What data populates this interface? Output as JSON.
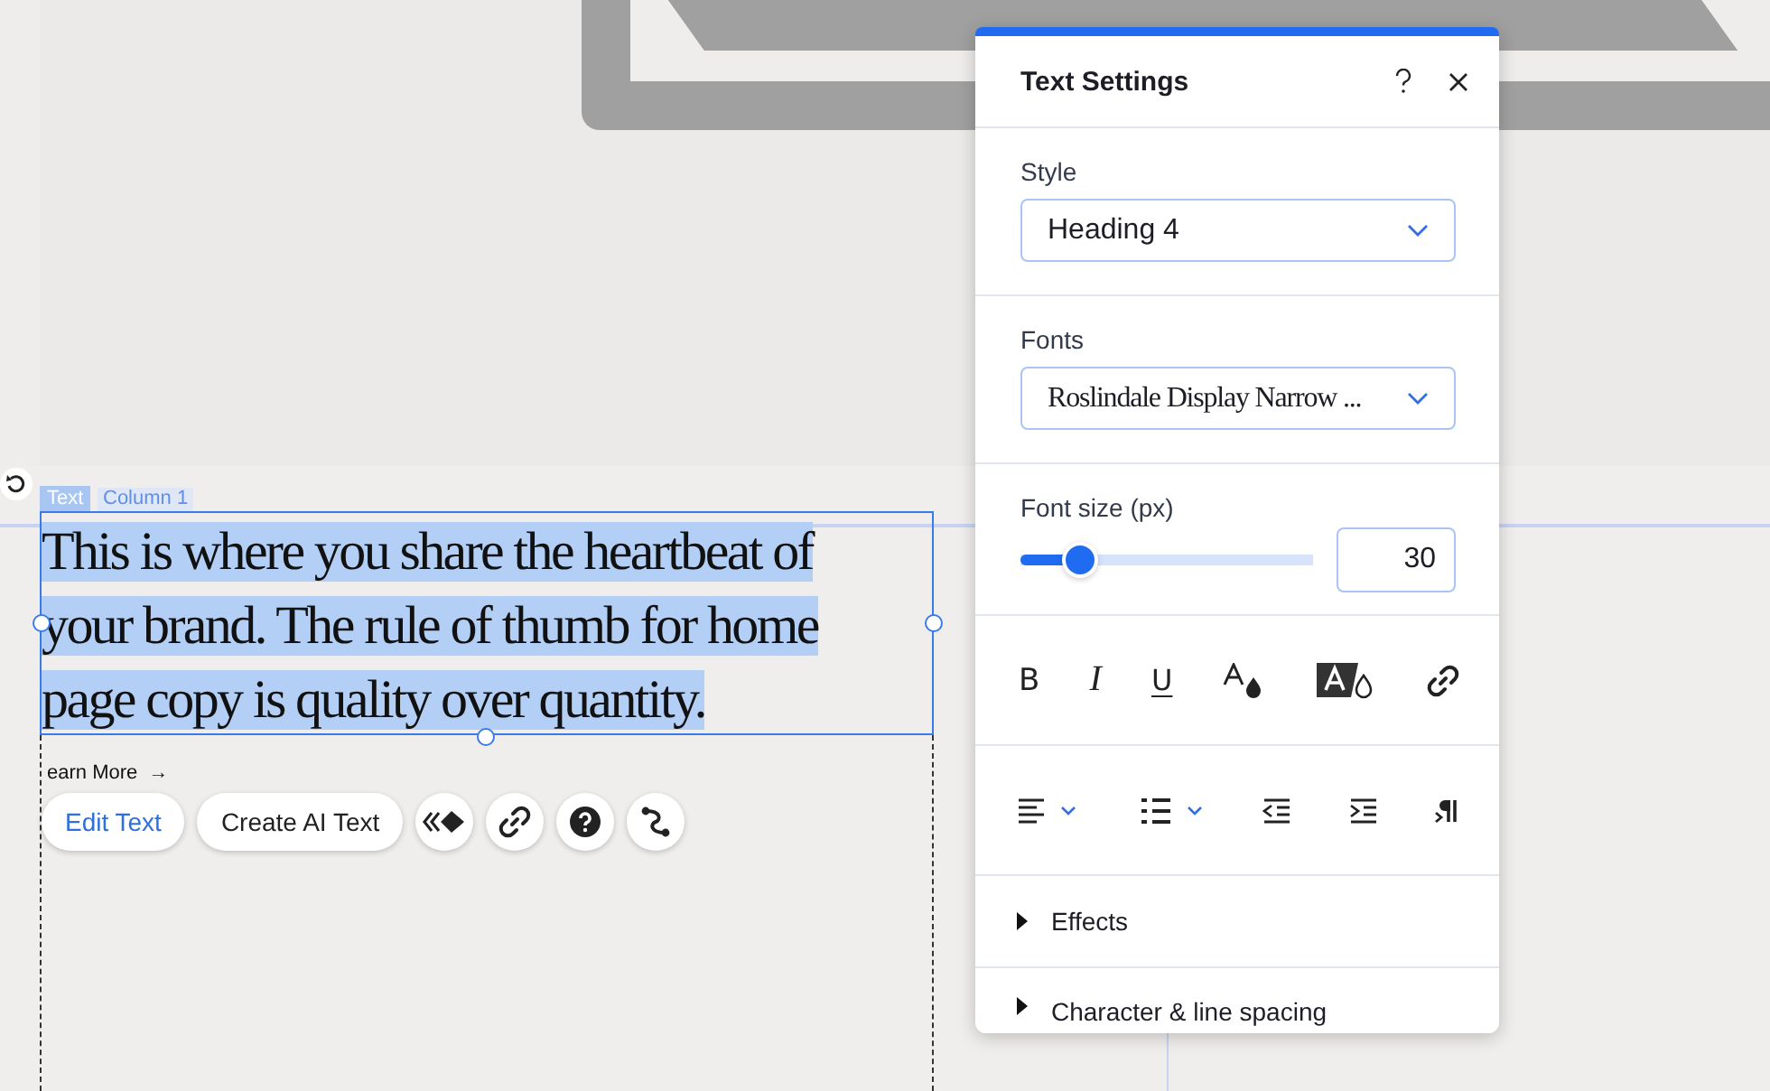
{
  "canvas": {
    "element_tag": "Text",
    "column_label": "Column 1",
    "heading_text": "This is where you share the heartbeat of your brand. The rule of thumb for home page copy is quality over quantity.",
    "link_text": "earn More",
    "link_arrow": "→",
    "toolbar": [
      {
        "kind": "text",
        "label": "Edit Text",
        "primary": true
      },
      {
        "kind": "text",
        "label": "Create AI Text",
        "primary": false
      },
      {
        "kind": "animation"
      },
      {
        "kind": "link"
      },
      {
        "kind": "help"
      },
      {
        "kind": "connect"
      }
    ]
  },
  "panel": {
    "title": "Text Settings",
    "style": {
      "label": "Style",
      "value": "Heading 4"
    },
    "fonts": {
      "label": "Fonts",
      "value": "Roslindale Display Narrow ..."
    },
    "font_size": {
      "label": "Font size (px)",
      "level": 0.17,
      "value": "30"
    },
    "format_buttons": [
      {
        "kind": "bold",
        "label": "B"
      },
      {
        "kind": "italic",
        "label": "I"
      },
      {
        "kind": "underline",
        "label": "U"
      }
    ],
    "sections": [
      {
        "label": "Effects",
        "expanded": false
      },
      {
        "label": "Character & line spacing",
        "expanded": false
      }
    ]
  }
}
